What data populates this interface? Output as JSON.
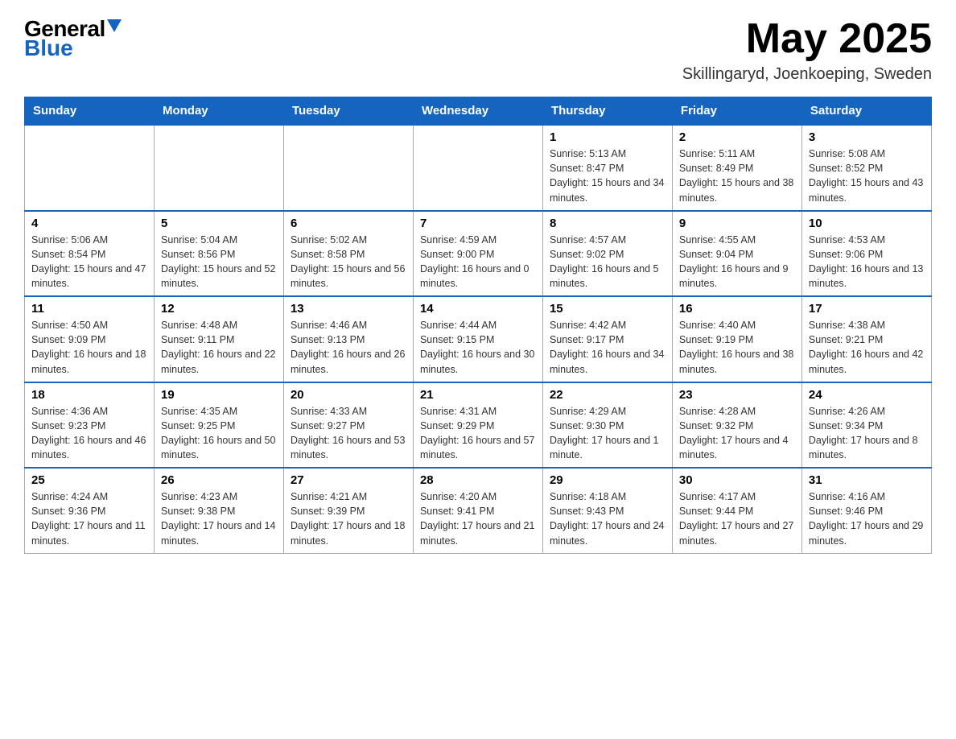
{
  "logo": {
    "general": "General",
    "blue": "Blue"
  },
  "title": {
    "month": "May 2025",
    "location": "Skillingaryd, Joenkoeping, Sweden"
  },
  "weekdays": [
    "Sunday",
    "Monday",
    "Tuesday",
    "Wednesday",
    "Thursday",
    "Friday",
    "Saturday"
  ],
  "weeks": [
    [
      {
        "day": "",
        "info": ""
      },
      {
        "day": "",
        "info": ""
      },
      {
        "day": "",
        "info": ""
      },
      {
        "day": "",
        "info": ""
      },
      {
        "day": "1",
        "info": "Sunrise: 5:13 AM\nSunset: 8:47 PM\nDaylight: 15 hours and 34 minutes."
      },
      {
        "day": "2",
        "info": "Sunrise: 5:11 AM\nSunset: 8:49 PM\nDaylight: 15 hours and 38 minutes."
      },
      {
        "day": "3",
        "info": "Sunrise: 5:08 AM\nSunset: 8:52 PM\nDaylight: 15 hours and 43 minutes."
      }
    ],
    [
      {
        "day": "4",
        "info": "Sunrise: 5:06 AM\nSunset: 8:54 PM\nDaylight: 15 hours and 47 minutes."
      },
      {
        "day": "5",
        "info": "Sunrise: 5:04 AM\nSunset: 8:56 PM\nDaylight: 15 hours and 52 minutes."
      },
      {
        "day": "6",
        "info": "Sunrise: 5:02 AM\nSunset: 8:58 PM\nDaylight: 15 hours and 56 minutes."
      },
      {
        "day": "7",
        "info": "Sunrise: 4:59 AM\nSunset: 9:00 PM\nDaylight: 16 hours and 0 minutes."
      },
      {
        "day": "8",
        "info": "Sunrise: 4:57 AM\nSunset: 9:02 PM\nDaylight: 16 hours and 5 minutes."
      },
      {
        "day": "9",
        "info": "Sunrise: 4:55 AM\nSunset: 9:04 PM\nDaylight: 16 hours and 9 minutes."
      },
      {
        "day": "10",
        "info": "Sunrise: 4:53 AM\nSunset: 9:06 PM\nDaylight: 16 hours and 13 minutes."
      }
    ],
    [
      {
        "day": "11",
        "info": "Sunrise: 4:50 AM\nSunset: 9:09 PM\nDaylight: 16 hours and 18 minutes."
      },
      {
        "day": "12",
        "info": "Sunrise: 4:48 AM\nSunset: 9:11 PM\nDaylight: 16 hours and 22 minutes."
      },
      {
        "day": "13",
        "info": "Sunrise: 4:46 AM\nSunset: 9:13 PM\nDaylight: 16 hours and 26 minutes."
      },
      {
        "day": "14",
        "info": "Sunrise: 4:44 AM\nSunset: 9:15 PM\nDaylight: 16 hours and 30 minutes."
      },
      {
        "day": "15",
        "info": "Sunrise: 4:42 AM\nSunset: 9:17 PM\nDaylight: 16 hours and 34 minutes."
      },
      {
        "day": "16",
        "info": "Sunrise: 4:40 AM\nSunset: 9:19 PM\nDaylight: 16 hours and 38 minutes."
      },
      {
        "day": "17",
        "info": "Sunrise: 4:38 AM\nSunset: 9:21 PM\nDaylight: 16 hours and 42 minutes."
      }
    ],
    [
      {
        "day": "18",
        "info": "Sunrise: 4:36 AM\nSunset: 9:23 PM\nDaylight: 16 hours and 46 minutes."
      },
      {
        "day": "19",
        "info": "Sunrise: 4:35 AM\nSunset: 9:25 PM\nDaylight: 16 hours and 50 minutes."
      },
      {
        "day": "20",
        "info": "Sunrise: 4:33 AM\nSunset: 9:27 PM\nDaylight: 16 hours and 53 minutes."
      },
      {
        "day": "21",
        "info": "Sunrise: 4:31 AM\nSunset: 9:29 PM\nDaylight: 16 hours and 57 minutes."
      },
      {
        "day": "22",
        "info": "Sunrise: 4:29 AM\nSunset: 9:30 PM\nDaylight: 17 hours and 1 minute."
      },
      {
        "day": "23",
        "info": "Sunrise: 4:28 AM\nSunset: 9:32 PM\nDaylight: 17 hours and 4 minutes."
      },
      {
        "day": "24",
        "info": "Sunrise: 4:26 AM\nSunset: 9:34 PM\nDaylight: 17 hours and 8 minutes."
      }
    ],
    [
      {
        "day": "25",
        "info": "Sunrise: 4:24 AM\nSunset: 9:36 PM\nDaylight: 17 hours and 11 minutes."
      },
      {
        "day": "26",
        "info": "Sunrise: 4:23 AM\nSunset: 9:38 PM\nDaylight: 17 hours and 14 minutes."
      },
      {
        "day": "27",
        "info": "Sunrise: 4:21 AM\nSunset: 9:39 PM\nDaylight: 17 hours and 18 minutes."
      },
      {
        "day": "28",
        "info": "Sunrise: 4:20 AM\nSunset: 9:41 PM\nDaylight: 17 hours and 21 minutes."
      },
      {
        "day": "29",
        "info": "Sunrise: 4:18 AM\nSunset: 9:43 PM\nDaylight: 17 hours and 24 minutes."
      },
      {
        "day": "30",
        "info": "Sunrise: 4:17 AM\nSunset: 9:44 PM\nDaylight: 17 hours and 27 minutes."
      },
      {
        "day": "31",
        "info": "Sunrise: 4:16 AM\nSunset: 9:46 PM\nDaylight: 17 hours and 29 minutes."
      }
    ]
  ]
}
